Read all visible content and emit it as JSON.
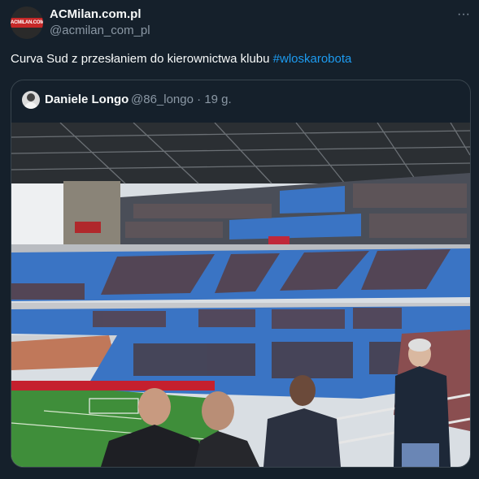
{
  "tweet": {
    "display_name": "ACMilan.com.pl",
    "handle": "@acmilan_com_pl",
    "avatar_logo_text": "ACMILAN.COM.PL",
    "text": "Curva Sud z przesłaniem do kierownictwa klubu ",
    "hashtag": "#wloskarobota",
    "more_icon": "more-horizontal-icon"
  },
  "quote": {
    "display_name": "Daniele Longo",
    "handle": "@86_longo",
    "separator": "·",
    "time": "19 g.",
    "media_description_icon": "photo"
  },
  "colors": {
    "background": "#15202b",
    "text": "#f7f9f9",
    "secondary": "#8b98a5",
    "link": "#1d9bf0",
    "border": "#38444d",
    "seat_blue": "#3a74c4",
    "pitch_green": "#3f8e3a"
  }
}
